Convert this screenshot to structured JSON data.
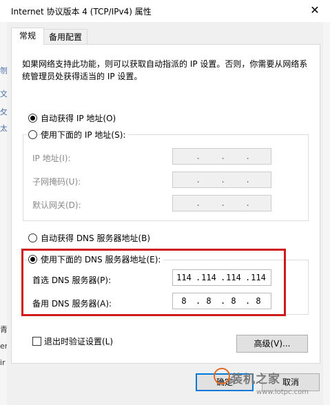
{
  "window": {
    "title": "Internet 协议版本 4 (TCP/IPv4) 属性",
    "close_glyph": "✕"
  },
  "tabs": [
    {
      "label": "常规",
      "active": true
    },
    {
      "label": "备用配置",
      "active": false
    }
  ],
  "description": "如果网络支持此功能，则可以获取自动指派的 IP 设置。否则，你需要从网络系统管理员处获得适当的 IP 设置。",
  "ip": {
    "auto_label": "自动获得 IP 地址(O)",
    "manual_label": "使用下面的 IP 地址(S):",
    "selected": "auto",
    "fields": [
      {
        "label": "IP 地址(I):",
        "octets": [
          "",
          "",
          "",
          ""
        ]
      },
      {
        "label": "子网掩码(U):",
        "octets": [
          "",
          "",
          "",
          ""
        ]
      },
      {
        "label": "默认网关(D):",
        "octets": [
          "",
          "",
          "",
          ""
        ]
      }
    ]
  },
  "dns": {
    "auto_label": "自动获得 DNS 服务器地址(B)",
    "manual_label": "使用下面的 DNS 服务器地址(E):",
    "selected": "manual",
    "preferred_label": "首选 DNS 服务器(P):",
    "preferred": [
      "114",
      "114",
      "114",
      "114"
    ],
    "alternate_label": "备用 DNS 服务器(A):",
    "alternate": [
      "8",
      "8",
      "8",
      "8"
    ]
  },
  "validate_on_exit": {
    "label": "退出时验证设置(L)",
    "checked": false
  },
  "buttons": {
    "advanced": "高级(V)...",
    "ok": "确定",
    "cancel": "取消"
  },
  "background_text": [
    "刎",
    "文",
    "攵",
    "太",
    "青",
    "er",
    "ir"
  ],
  "watermark": {
    "text": "装机之家",
    "url": "www.lotpc.com"
  },
  "colors": {
    "highlight": "#d01a1a",
    "focus": "#0078d7"
  }
}
